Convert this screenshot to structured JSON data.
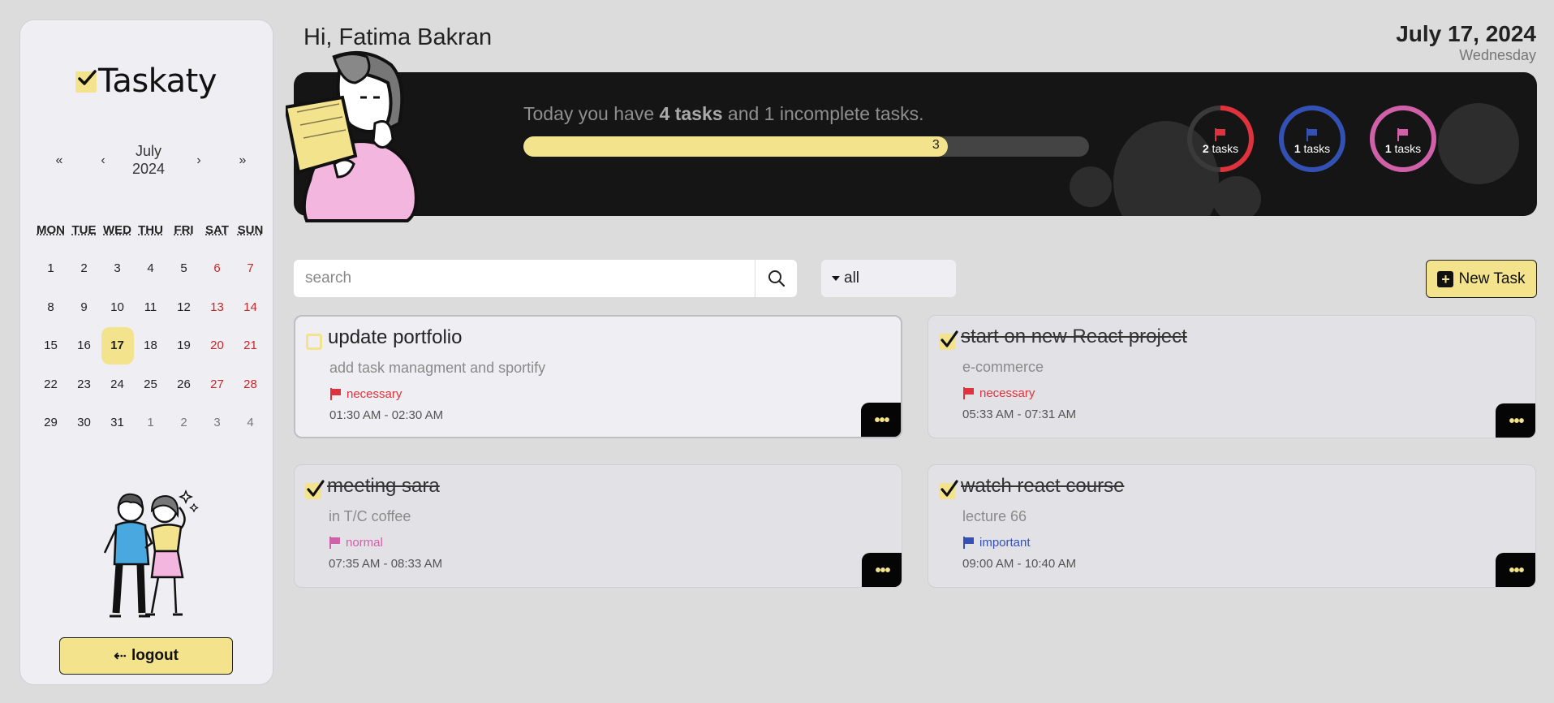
{
  "app": {
    "logo_text": "Taskaty"
  },
  "calendar": {
    "month": "July",
    "year": "2024",
    "nav": {
      "prev_year": "«",
      "prev_month": "‹",
      "next_month": "›",
      "next_year": "»"
    },
    "weekdays": [
      "MON",
      "TUE",
      "WED",
      "THU",
      "FRI",
      "SAT",
      "SUN"
    ],
    "days": [
      "1",
      "2",
      "3",
      "4",
      "5",
      "6",
      "7",
      "8",
      "9",
      "10",
      "11",
      "12",
      "13",
      "14",
      "15",
      "16",
      "17",
      "18",
      "19",
      "20",
      "21",
      "22",
      "23",
      "24",
      "25",
      "26",
      "27",
      "28",
      "29",
      "30",
      "31",
      "1",
      "2",
      "3",
      "4"
    ],
    "today": "17"
  },
  "sidebar": {
    "logout_icon": "⇠",
    "logout_label": "logout"
  },
  "header": {
    "greeting": "Hi, Fatima Bakran",
    "date": "July 17, 2024",
    "weekday": "Wednesday"
  },
  "banner": {
    "summary_prefix": "Today you have ",
    "summary_tasks": "4 tasks",
    "summary_suffix": " and 1 incomplete tasks.",
    "progress_label": "3",
    "progress_fraction": 0.75,
    "rings": [
      {
        "count": "2",
        "unit": " tasks",
        "color": "#e0323c",
        "fraction": 0.5,
        "icon": "flag-icon"
      },
      {
        "count": "1",
        "unit": " tasks",
        "color": "#3350b5",
        "fraction": 1.0,
        "icon": "flag-icon"
      },
      {
        "count": "1",
        "unit": " tasks",
        "color": "#d060a8",
        "fraction": 1.0,
        "icon": "flag-icon"
      }
    ]
  },
  "toolbar": {
    "search_placeholder": "search",
    "filter_value": "all",
    "new_task_label": "New Task"
  },
  "colors": {
    "accent": "#f3e38c",
    "necessary": "#e0323c",
    "normal": "#d060a8",
    "important": "#3350b5"
  },
  "tasks": [
    {
      "title": "update portfolio",
      "description": "add task managment and sportify",
      "tag": "necessary",
      "tag_color": "#e0323c",
      "time": "01:30 AM - 02:30 AM",
      "done": false
    },
    {
      "title": "start on new React project",
      "description": "e-commerce",
      "tag": "necessary",
      "tag_color": "#e0323c",
      "time": "05:33 AM - 07:31 AM",
      "done": true
    },
    {
      "title": "meeting sara",
      "description": "in T/C coffee",
      "tag": "normal",
      "tag_color": "#d060a8",
      "time": "07:35 AM - 08:33 AM",
      "done": true
    },
    {
      "title": "watch react course",
      "description": "lecture 66",
      "tag": "important",
      "tag_color": "#3350b5",
      "time": "09:00 AM - 10:40 AM",
      "done": true
    }
  ],
  "task_menu_icon": "•••"
}
